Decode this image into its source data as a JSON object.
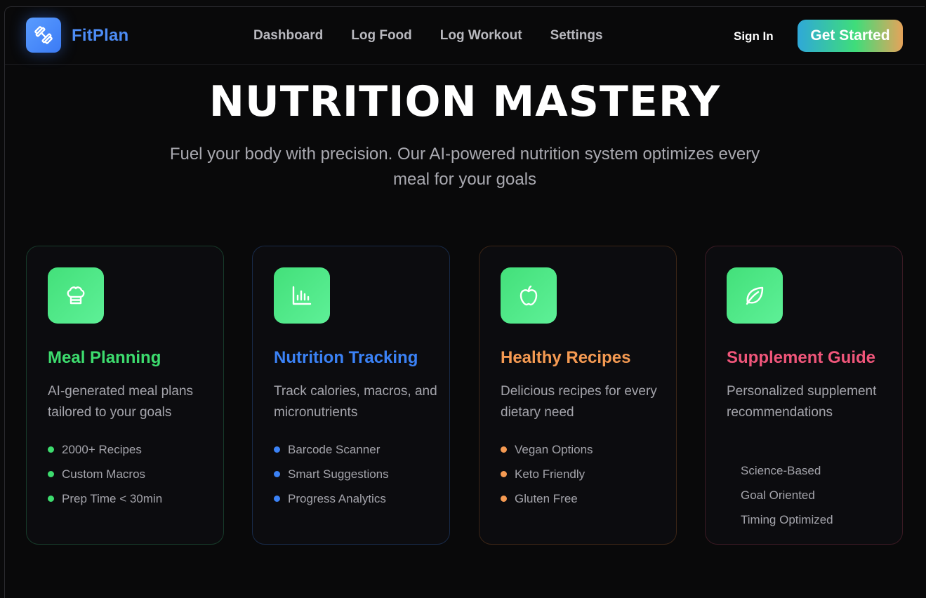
{
  "header": {
    "brand": "FitPlan",
    "logo_icon": "dumbbell-icon",
    "nav": [
      "Dashboard",
      "Log Food",
      "Log Workout",
      "Settings"
    ],
    "signin_label": "Sign In",
    "cta_label": "Get Started"
  },
  "hero": {
    "title": "NUTRITION MASTERY",
    "subtitle": "Fuel your body with precision. Our AI-powered nutrition system optimizes every meal for your goals"
  },
  "cards": [
    {
      "icon": "chef-hat-icon",
      "title": "Meal Planning",
      "title_color": "#3ddc6e",
      "border_color": "#173a2a",
      "bullet_color": "#3ddc6e",
      "description": "AI-generated meal plans tailored to your goals",
      "features": [
        "2000+ Recipes",
        "Custom Macros",
        "Prep Time < 30min"
      ]
    },
    {
      "icon": "bar-chart-icon",
      "title": "Nutrition Tracking",
      "title_color": "#3b82f6",
      "border_color": "#182a48",
      "bullet_color": "#3b82f6",
      "description": "Track calories, macros, and micronutrients",
      "features": [
        "Barcode Scanner",
        "Smart Suggestions",
        "Progress Analytics"
      ]
    },
    {
      "icon": "apple-icon",
      "title": "Healthy Recipes",
      "title_color": "#f59a52",
      "border_color": "#3b2516",
      "bullet_color": "#f59a52",
      "description": "Delicious recipes for every dietary need",
      "features": [
        "Vegan Options",
        "Keto Friendly",
        "Gluten Free"
      ]
    },
    {
      "icon": "leaf-icon",
      "title": "Supplement Guide",
      "title_color": "#f0567a",
      "border_color": "#3a1a24",
      "bullet_color": "transparent",
      "description": "Personalized supplement recommendations",
      "features": [
        "Science-Based",
        "Goal Oriented",
        "Timing Optimized"
      ]
    }
  ]
}
